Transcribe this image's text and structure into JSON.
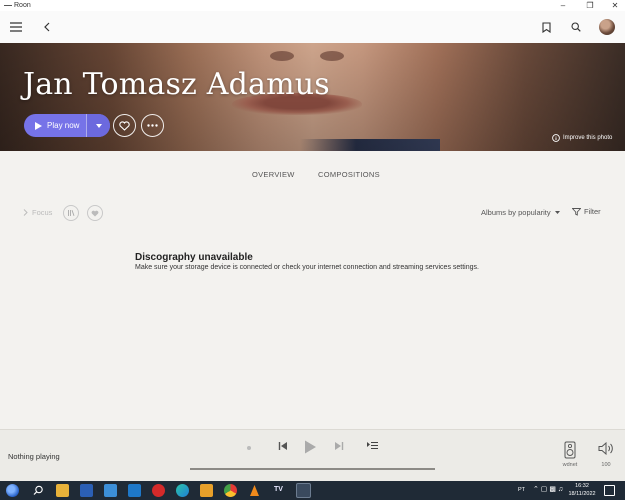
{
  "window": {
    "title": "Roon"
  },
  "artist": {
    "name": "Jan Tomasz Adamus"
  },
  "hero": {
    "play_label": "Play now",
    "improve_label": "Improve this photo"
  },
  "tabs": [
    {
      "label": "OVERVIEW"
    },
    {
      "label": "COMPOSITIONS"
    }
  ],
  "filters": {
    "focus_label": "Focus",
    "sort_label": "Albums by popularity",
    "filter_label": "Filter"
  },
  "empty": {
    "title": "Discography unavailable",
    "message": "Make sure your storage device is connected or check your internet connection and streaming services settings."
  },
  "player": {
    "now_playing": "Nothing playing",
    "zone_label": "wdnet",
    "volume": "100"
  },
  "taskbar": {
    "lang": "PT",
    "time": "16:32",
    "date": "18/11/2022",
    "tv_label": "TV"
  },
  "colors": {
    "accent": "#7673e8",
    "background": "#f3f2ef",
    "taskbar": "#1f2a36"
  }
}
